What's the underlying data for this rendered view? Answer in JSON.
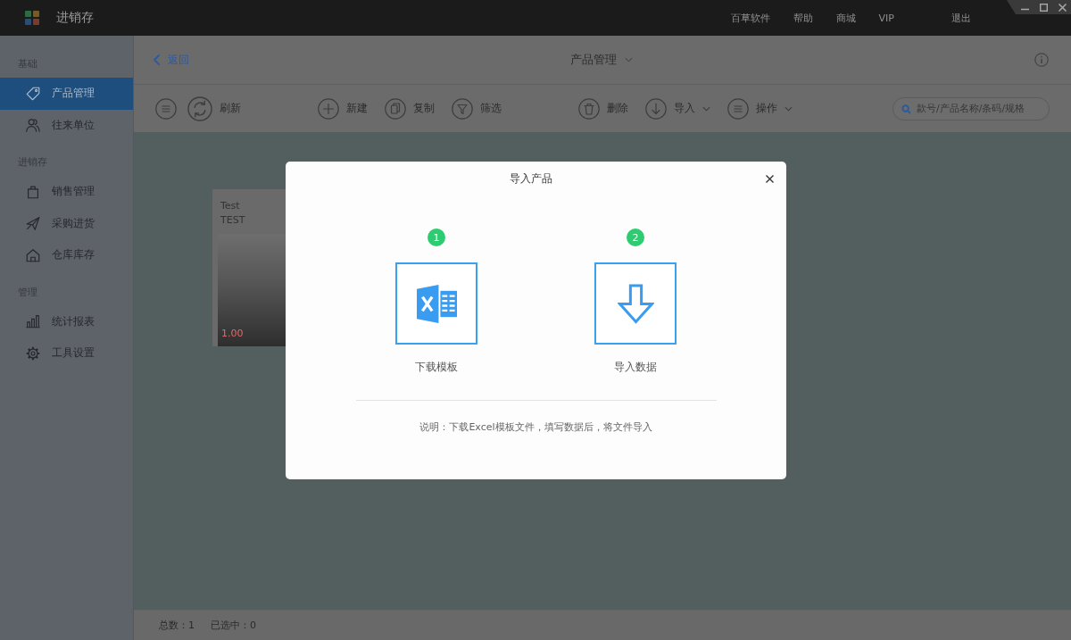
{
  "title_bar": {
    "app_name": "进销存",
    "menu": [
      "百草软件",
      "帮助",
      "商城",
      "VIP",
      "退出"
    ]
  },
  "sidebar": {
    "sections": [
      {
        "label": "基础",
        "items": [
          {
            "kind": "product",
            "label": "产品管理",
            "selected": true
          },
          {
            "kind": "partner",
            "label": "往来单位",
            "selected": false
          }
        ]
      },
      {
        "label": "进销存",
        "items": [
          {
            "kind": "sales",
            "label": "销售管理",
            "selected": false
          },
          {
            "kind": "purchase",
            "label": "采购进货",
            "selected": false
          },
          {
            "kind": "stock",
            "label": "仓库库存",
            "selected": false
          }
        ]
      },
      {
        "label": "管理",
        "items": [
          {
            "kind": "report",
            "label": "统计报表",
            "selected": false
          },
          {
            "kind": "settings",
            "label": "工具设置",
            "selected": false
          }
        ]
      }
    ]
  },
  "header": {
    "back": "返回",
    "title": "产品管理"
  },
  "toolbar": {
    "groups": [
      [
        {
          "kind": "refresh",
          "label": "刷新",
          "dropdown": false
        }
      ],
      [
        {
          "kind": "new",
          "label": "新建",
          "dropdown": false
        },
        {
          "kind": "copy",
          "label": "复制",
          "dropdown": false
        },
        {
          "kind": "filter",
          "label": "筛选",
          "dropdown": false
        }
      ],
      [
        {
          "kind": "delete",
          "label": "删除",
          "dropdown": false
        },
        {
          "kind": "import",
          "label": "导入",
          "dropdown": true
        },
        {
          "kind": "actions",
          "label": "操作",
          "dropdown": true
        }
      ]
    ],
    "search": {
      "placeholder": "款号/产品名称/条码/规格"
    }
  },
  "products": [
    {
      "name": "Test",
      "code": "TEST",
      "price": "1.00"
    }
  ],
  "status_bar": {
    "total": "总数：1",
    "selected": "已选中：0"
  },
  "dialog": {
    "title": "导入产品",
    "steps": [
      {
        "kind": "template",
        "number": "1",
        "label": "下载模板"
      },
      {
        "kind": "import",
        "number": "2",
        "label": "导入数据"
      }
    ],
    "note": "说明：下载Excel模板文件，填写数据后，将文件导入"
  }
}
